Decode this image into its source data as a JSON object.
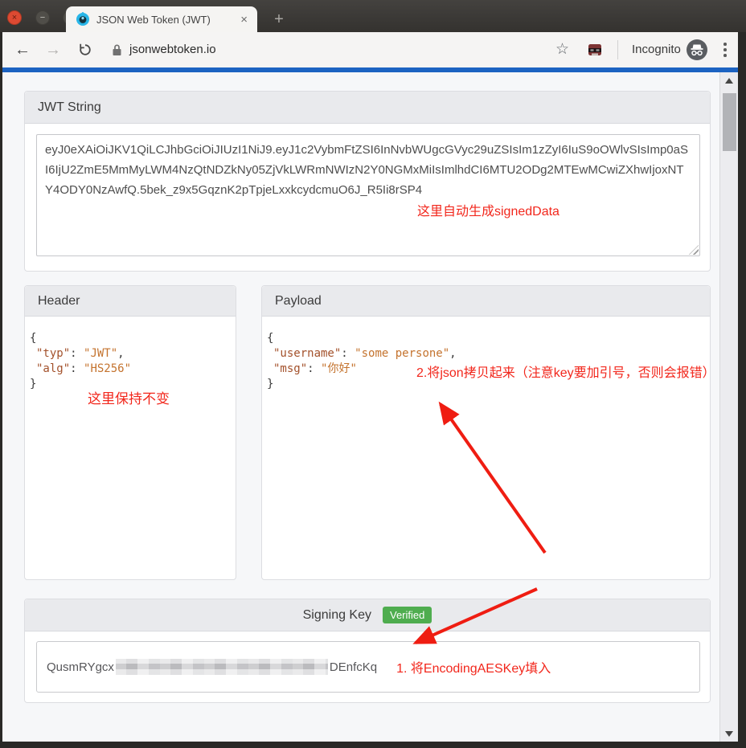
{
  "browser": {
    "window_controls": {
      "close": "×",
      "minimize": "−"
    },
    "tab": {
      "title": "JSON Web Token (JWT)",
      "close": "×"
    },
    "new_tab": "+",
    "toolbar": {
      "back": "←",
      "forward": "→",
      "star": "☆",
      "url": "jsonwebtoken.io",
      "incognito_label": "Incognito"
    }
  },
  "page": {
    "jwt_panel": {
      "title": "JWT String",
      "token": "eyJ0eXAiOiJKV1QiLCJhbGciOiJIUzI1NiJ9.eyJ1c2VybmFtZSI6InNvbWUgcGVyc29uZSIsIm1zZyI6IuS9oOWlvSIsImp0aSI6IjU2ZmE5MmMyLWM4NzQtNDZkNy05ZjVkLWRmNWIzN2Y0NGMxMiIsImlhdCI6MTU2ODg2MTEwMCwiZXhwIjoxNTY4ODY0NzAwfQ.5bek_z9x5GqznK2pTpjeLxxkcydcmuO6J_R5Ii8rSP4",
      "annotation": "这里自动生成signedData"
    },
    "header_panel": {
      "title": "Header",
      "json": {
        "open": "{",
        "row1": {
          "key": "\"typ\"",
          "sep": ": ",
          "value": "\"JWT\"",
          "comma": ","
        },
        "row2": {
          "key": "\"alg\"",
          "sep": ": ",
          "value": "\"HS256\""
        },
        "close": "}"
      },
      "annotation": "这里保持不变"
    },
    "payload_panel": {
      "title": "Payload",
      "json": {
        "open": "{",
        "row1": {
          "key": "\"username\"",
          "sep": ": ",
          "value": "\"some persone\"",
          "comma": ","
        },
        "row2": {
          "key": "\"msg\"",
          "sep": ": ",
          "value": "\"你好\""
        },
        "close": "}"
      },
      "annotation": "2.将json拷贝起来（注意key要加引号，否则会报错）"
    },
    "signing_panel": {
      "title": "Signing Key",
      "badge": "Verified",
      "key_prefix": "QusmRYgcx",
      "key_suffix": "DEnfcKq",
      "annotation": "1. 将EncodingAESKey填入"
    }
  },
  "colors": {
    "accent_blue": "#1c63c2",
    "annotation_red": "#f2271c",
    "verified_green": "#4fad4f",
    "json_key": "#a3512b",
    "json_value": "#c4732e"
  }
}
